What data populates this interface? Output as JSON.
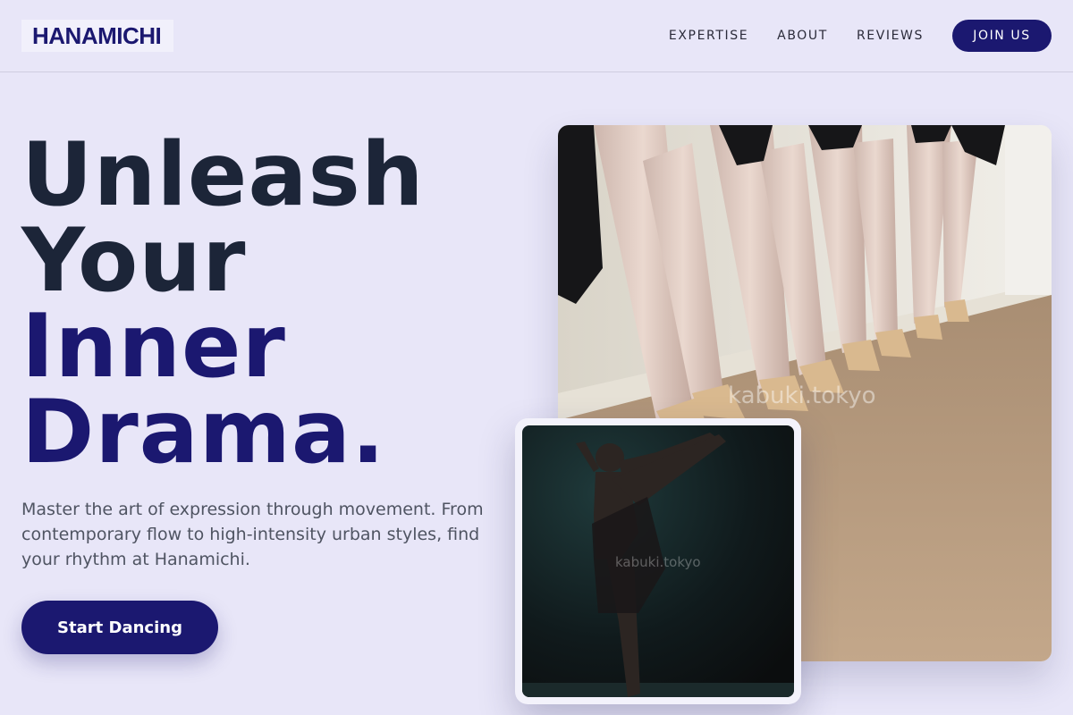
{
  "brand": {
    "logo_text": "HANAMICHI"
  },
  "nav": {
    "links": [
      "EXPERTISE",
      "ABOUT",
      "REVIEWS"
    ],
    "cta_label": "JOIN US"
  },
  "hero": {
    "title_line1": "Unleash",
    "title_line2": "Your",
    "title_line3": "Inner",
    "title_line4": "Drama.",
    "subtitle": "Master the art of expression through movement. From contemporary flow to high-intensity urban styles, find your rhythm at Hanamichi.",
    "cta_label": "Start Dancing"
  },
  "images": {
    "main_watermark": "kabuki.tokyo",
    "card_watermark": "kabuki.tokyo"
  },
  "colors": {
    "background": "#e8e6f8",
    "brand": "#1b1870",
    "heading_dark": "#1c2538"
  }
}
